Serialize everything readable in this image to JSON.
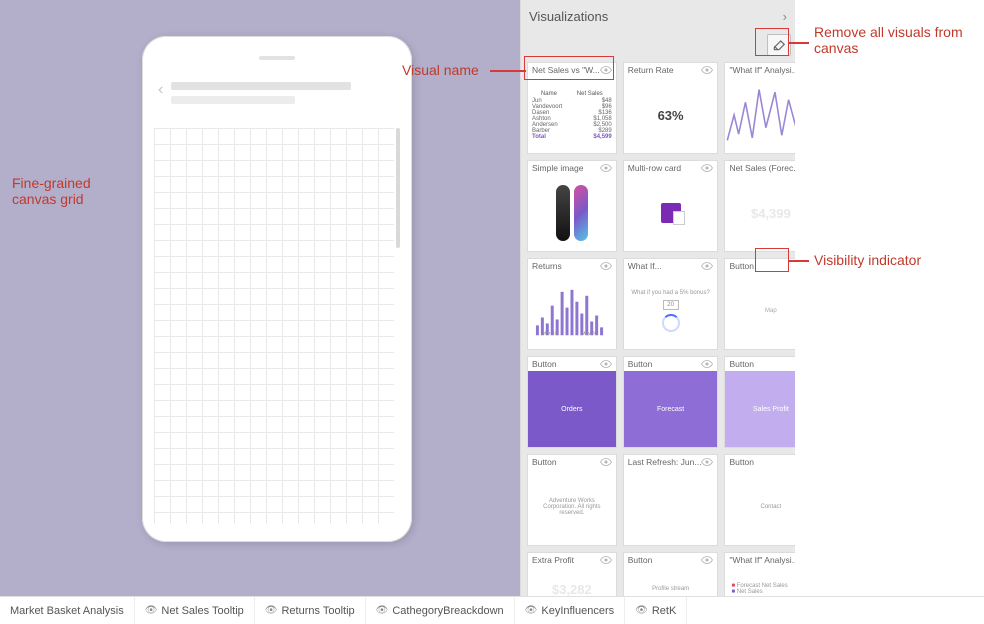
{
  "panel": {
    "title": "Visualizations"
  },
  "annotations": {
    "canvas_grid": "Fine-grained canvas grid",
    "visual_name": "Visual name",
    "remove_all": "Remove all visuals from canvas",
    "visibility": "Visibility indicator"
  },
  "tabs": [
    {
      "label": "Market Basket Analysis",
      "hidden": false
    },
    {
      "label": "Net Sales Tooltip",
      "hidden": true
    },
    {
      "label": "Returns Tooltip",
      "hidden": true
    },
    {
      "label": "CathegoryBreackdown",
      "hidden": true
    },
    {
      "label": "KeyInfluencers",
      "hidden": true
    },
    {
      "label": "RetK",
      "hidden": true
    }
  ],
  "tiles": [
    {
      "title": "Net Sales vs \"W...",
      "kind": "table"
    },
    {
      "title": "Return Rate",
      "kind": "kpi",
      "value": "63%"
    },
    {
      "title": "\"What If\" Analysi...",
      "kind": "line"
    },
    {
      "title": "Simple image",
      "kind": "image"
    },
    {
      "title": "Multi-row card",
      "kind": "mrc"
    },
    {
      "title": "Net Sales (Forec...",
      "kind": "bignum",
      "value": "$4,399"
    },
    {
      "title": "Returns",
      "kind": "histo"
    },
    {
      "title": "What If...",
      "kind": "whatif",
      "sub": "20"
    },
    {
      "title": "Button",
      "kind": "map",
      "map_label": "Map"
    },
    {
      "title": "Button",
      "kind": "solid",
      "shade": "dark",
      "btn": "Orders"
    },
    {
      "title": "Button",
      "kind": "solid",
      "shade": "mid",
      "btn": "Forecast"
    },
    {
      "title": "Button",
      "kind": "solid",
      "shade": "light",
      "btn": "Sales Profit"
    },
    {
      "title": "Button",
      "kind": "text",
      "text": "Adventure Works Corporation. All rights reserved."
    },
    {
      "title": "Last Refresh: Jun...",
      "kind": "empty"
    },
    {
      "title": "Button",
      "kind": "text",
      "text": "Contact"
    },
    {
      "title": "Extra Profit",
      "kind": "bignum",
      "value": "$3,282"
    },
    {
      "title": "Button",
      "kind": "text",
      "text": "Profile stream"
    },
    {
      "title": "\"What If\" Analysi...",
      "kind": "legend"
    }
  ],
  "table_tile": {
    "headers": [
      "Name",
      "Net Sales"
    ],
    "rows": [
      [
        "Jun",
        "$48"
      ],
      [
        "Vandevoort",
        "$96"
      ],
      [
        "Dasen",
        "$136"
      ],
      [
        "Ashton",
        "$1,058"
      ],
      [
        "Andersen",
        "$2,500"
      ],
      [
        "Barber",
        "$289"
      ]
    ],
    "total_label": "Total",
    "total_value": "$4,599"
  }
}
